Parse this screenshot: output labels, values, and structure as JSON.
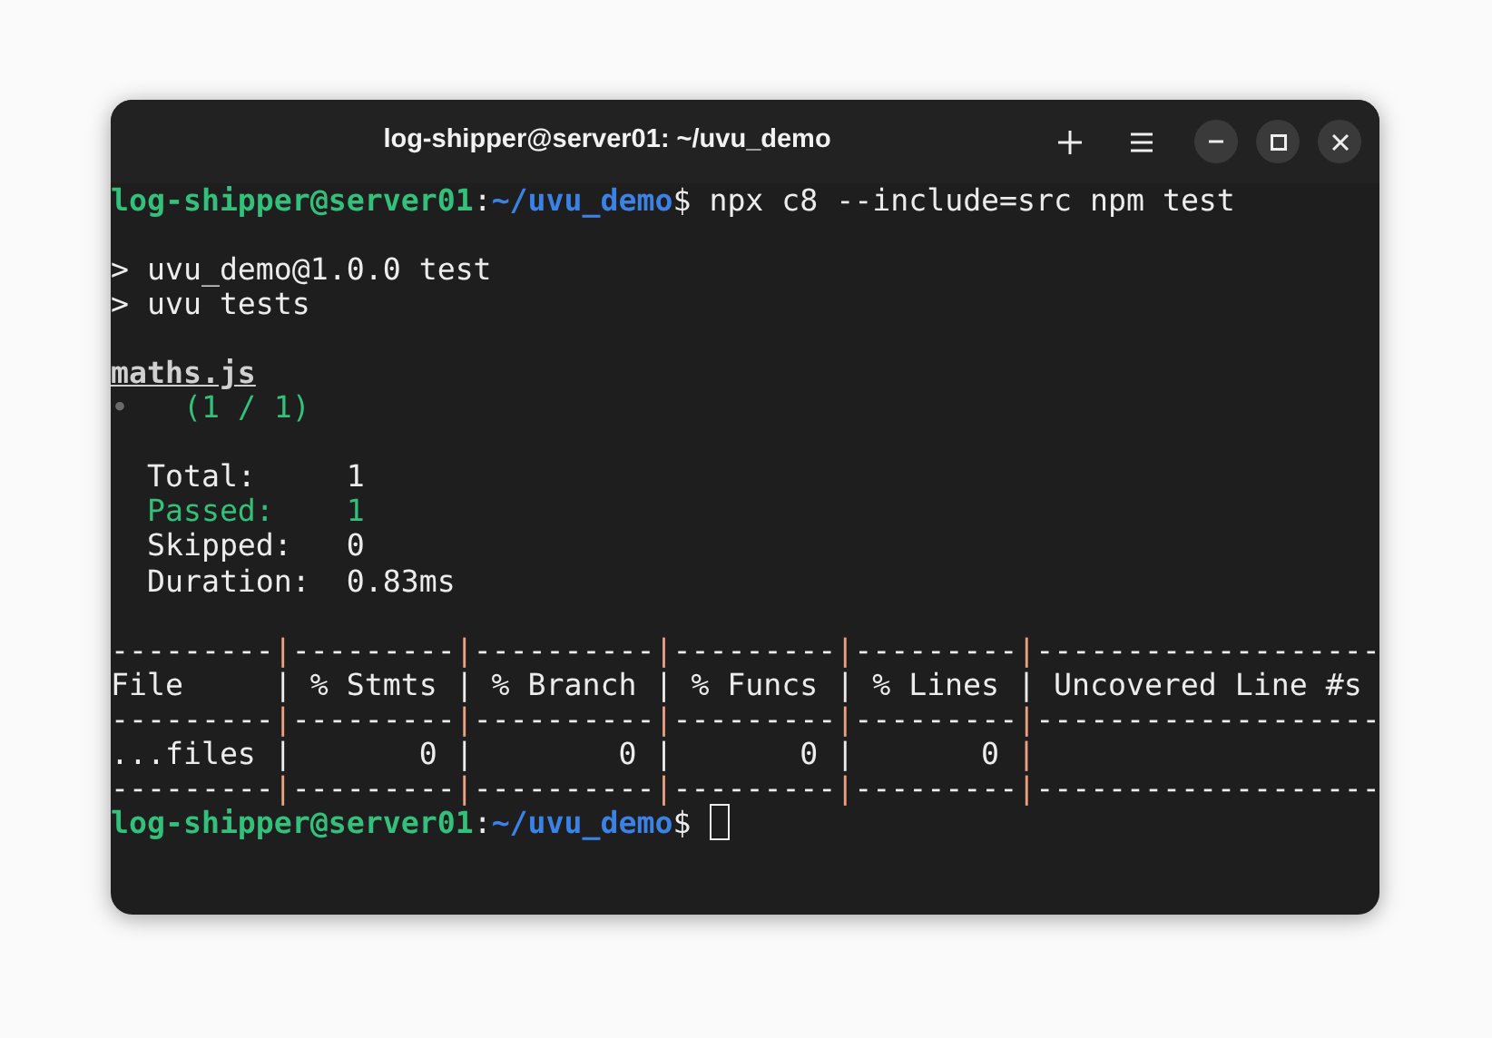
{
  "window": {
    "title": "log-shipper@server01: ~/uvu_demo"
  },
  "terminal": {
    "lines": [
      {
        "kind": "text",
        "segments": [
          {
            "kind": "user",
            "text": "log-shipper@server01"
          },
          {
            "kind": "plain",
            "text": ":"
          },
          {
            "kind": "path",
            "text": "~/uvu_demo"
          },
          {
            "kind": "plain",
            "text": "$ npx c8 --include=src npm test"
          }
        ]
      },
      {
        "kind": "blank"
      },
      {
        "kind": "text",
        "segments": [
          {
            "kind": "plain",
            "text": "> uvu_demo@1.0.0 test"
          }
        ]
      },
      {
        "kind": "text",
        "segments": [
          {
            "kind": "plain",
            "text": "> uvu tests"
          }
        ]
      },
      {
        "kind": "blank"
      },
      {
        "kind": "text",
        "segments": [
          {
            "kind": "underline",
            "text": "maths.js"
          }
        ]
      },
      {
        "kind": "text",
        "segments": [
          {
            "kind": "dim",
            "text": "•"
          },
          {
            "kind": "green",
            "text": "   (1 / 1)"
          }
        ]
      },
      {
        "kind": "blank"
      },
      {
        "kind": "text",
        "segments": [
          {
            "kind": "plain",
            "text": "  Total:     1"
          }
        ]
      },
      {
        "kind": "text",
        "segments": [
          {
            "kind": "green",
            "text": "  Passed:    1"
          }
        ]
      },
      {
        "kind": "text",
        "segments": [
          {
            "kind": "plain",
            "text": "  Skipped:   0"
          }
        ]
      },
      {
        "kind": "text",
        "segments": [
          {
            "kind": "plain",
            "text": "  Duration:  0.83ms"
          }
        ]
      },
      {
        "kind": "blank"
      },
      {
        "kind": "text",
        "segments": [
          {
            "kind": "plain",
            "text": "---------"
          },
          {
            "kind": "border",
            "text": "|"
          },
          {
            "kind": "plain",
            "text": "---------"
          },
          {
            "kind": "border",
            "text": "|"
          },
          {
            "kind": "plain",
            "text": "----------"
          },
          {
            "kind": "border",
            "text": "|"
          },
          {
            "kind": "plain",
            "text": "---------"
          },
          {
            "kind": "border",
            "text": "|"
          },
          {
            "kind": "plain",
            "text": "---------"
          },
          {
            "kind": "border",
            "text": "|"
          },
          {
            "kind": "plain",
            "text": "-------------------"
          }
        ]
      },
      {
        "kind": "text",
        "segments": [
          {
            "kind": "plain",
            "text": "File     | % Stmts | % Branch | % Funcs | % Lines | Uncovered Line #s"
          }
        ]
      },
      {
        "kind": "text",
        "segments": [
          {
            "kind": "plain",
            "text": "---------"
          },
          {
            "kind": "border",
            "text": "|"
          },
          {
            "kind": "plain",
            "text": "---------"
          },
          {
            "kind": "border",
            "text": "|"
          },
          {
            "kind": "plain",
            "text": "----------"
          },
          {
            "kind": "border",
            "text": "|"
          },
          {
            "kind": "plain",
            "text": "---------"
          },
          {
            "kind": "border",
            "text": "|"
          },
          {
            "kind": "plain",
            "text": "---------"
          },
          {
            "kind": "border",
            "text": "|"
          },
          {
            "kind": "plain",
            "text": "-------------------"
          }
        ]
      },
      {
        "kind": "text",
        "segments": [
          {
            "kind": "plain",
            "text": "...files |       0 |        0 |       0 |       0 "
          },
          {
            "kind": "border",
            "text": "|"
          }
        ]
      },
      {
        "kind": "text",
        "segments": [
          {
            "kind": "plain",
            "text": "---------"
          },
          {
            "kind": "border",
            "text": "|"
          },
          {
            "kind": "plain",
            "text": "---------"
          },
          {
            "kind": "border",
            "text": "|"
          },
          {
            "kind": "plain",
            "text": "----------"
          },
          {
            "kind": "border",
            "text": "|"
          },
          {
            "kind": "plain",
            "text": "---------"
          },
          {
            "kind": "border",
            "text": "|"
          },
          {
            "kind": "plain",
            "text": "---------"
          },
          {
            "kind": "border",
            "text": "|"
          },
          {
            "kind": "plain",
            "text": "-------------------"
          }
        ]
      },
      {
        "kind": "prompt",
        "segments": [
          {
            "kind": "user",
            "text": "log-shipper@server01"
          },
          {
            "kind": "plain",
            "text": ":"
          },
          {
            "kind": "path",
            "text": "~/uvu_demo"
          },
          {
            "kind": "plain",
            "text": "$ "
          }
        ]
      }
    ]
  }
}
